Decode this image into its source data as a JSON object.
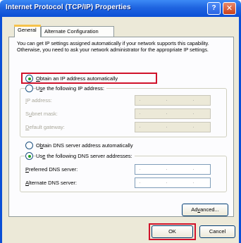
{
  "window": {
    "title": "Internet Protocol (TCP/IP) Properties",
    "help_glyph": "?",
    "close_glyph": "✕"
  },
  "tabs": [
    {
      "label": "General",
      "selected": true
    },
    {
      "label": "Alternate Configuration",
      "selected": false
    }
  ],
  "description": "You can get IP settings assigned automatically if your network supports this capability. Otherwise, you need to ask your network administrator for the appropriate IP settings.",
  "ip": {
    "auto_option": {
      "pre": "",
      "u": "O",
      "post": "btain an IP address automatically",
      "selected": true
    },
    "manual_option": {
      "pre": "U",
      "u": "s",
      "post": "e the following IP address:",
      "selected": false
    },
    "fields": [
      {
        "pre": "",
        "u": "I",
        "post": "P address:",
        "value": ". . ."
      },
      {
        "pre": "S",
        "u": "u",
        "post": "bnet mask:",
        "value": ". . ."
      },
      {
        "pre": "",
        "u": "D",
        "post": "efault gateway:",
        "value": ". . ."
      }
    ]
  },
  "dns": {
    "auto_option": {
      "pre": "O",
      "u": "b",
      "post": "tain DNS server address automatically",
      "selected": false
    },
    "manual_option": {
      "pre": "Us",
      "u": "e",
      "post": " the following DNS server addresses:",
      "selected": true
    },
    "fields": [
      {
        "pre": "",
        "u": "P",
        "post": "referred DNS server:",
        "value": ". . ."
      },
      {
        "pre": "",
        "u": "A",
        "post": "lternate DNS server:",
        "value": ". . ."
      }
    ]
  },
  "buttons": {
    "advanced": {
      "pre": "Ad",
      "u": "v",
      "post": "anced..."
    },
    "ok": "OK",
    "cancel": "Cancel"
  },
  "colors": {
    "titlebar": "#0b4fd6",
    "highlight": "#d0122a",
    "radio_dot": "#21a121",
    "dialog_bg": "#ece9d8"
  }
}
